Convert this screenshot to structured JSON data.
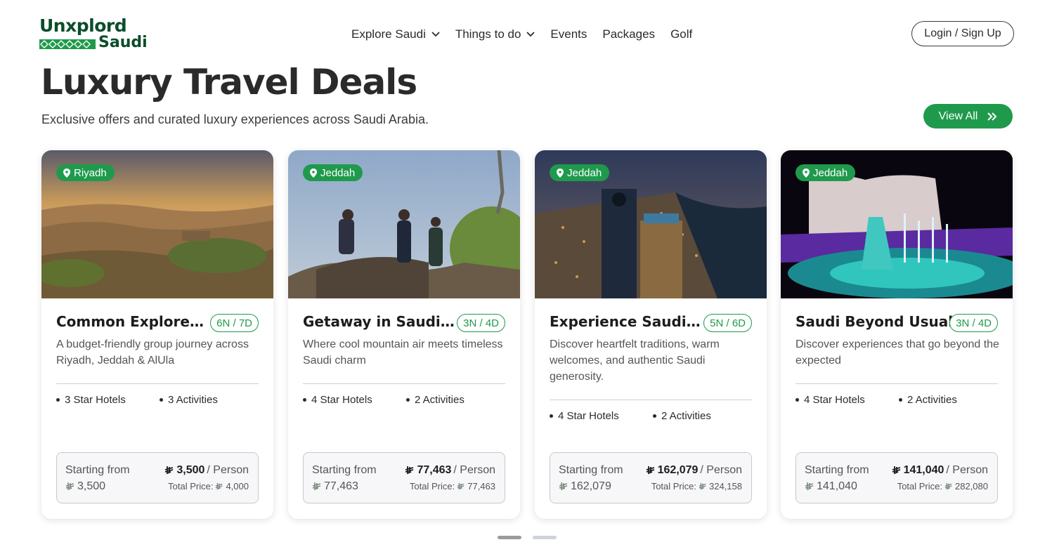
{
  "brand": {
    "logo_line1": "Unxplord",
    "logo_line2": "Saudi",
    "green": "#1f9a4c",
    "dark_green": "#0b4d2a"
  },
  "nav": {
    "items": [
      {
        "label": "Explore Saudi",
        "has_dropdown": true
      },
      {
        "label": "Things to do",
        "has_dropdown": true
      },
      {
        "label": "Events",
        "has_dropdown": false
      },
      {
        "label": "Packages",
        "has_dropdown": false
      },
      {
        "label": "Golf",
        "has_dropdown": false
      }
    ],
    "login_label": "Login / Sign Up"
  },
  "section": {
    "title": "Luxury Travel Deals",
    "subtitle": "Exclusive offers and curated luxury experiences across Saudi Arabia.",
    "view_all_label": "View All"
  },
  "cards": [
    {
      "location": "Riyadh",
      "title": "Common Explorer Saudi",
      "duration": "6N / 7D",
      "description": "A budget-friendly group journey across Riyadh, Jeddah & AlUla",
      "hotels": "3 Star Hotels",
      "activities": "3 Activities",
      "starting_label": "Starting from",
      "price": "3,500",
      "per_person": "/ Person",
      "starting_value": "3,500",
      "total_label": "Total Price:",
      "total_value": "4,000",
      "image": "desert-valley-photo"
    },
    {
      "location": "Jeddah",
      "title": "Getaway in Saudi Highlands",
      "duration": "3N / 4D",
      "description": "Where cool mountain air meets timeless Saudi charm",
      "hotels": "4 Star Hotels",
      "activities": "2 Activities",
      "starting_label": "Starting from",
      "price": "77,463",
      "per_person": "/ Person",
      "starting_value": "77,463",
      "total_label": "Total Price:",
      "total_value": "77,463",
      "image": "hikers-mountain-photo"
    },
    {
      "location": "Jeddah",
      "title": "Experience Saudi Hospitality",
      "duration": "5N / 6D",
      "description": "Discover heartfelt traditions, warm welcomes, and authentic Saudi generosity.",
      "hotels": "4 Star Hotels",
      "activities": "2 Activities",
      "starting_label": "Starting from",
      "price": "162,079",
      "per_person": "/ Person",
      "starting_value": "162,079",
      "total_label": "Total Price:",
      "total_value": "324,158",
      "image": "city-night-skyline-photo"
    },
    {
      "location": "Jeddah",
      "title": "Saudi Beyond Usual",
      "duration": "3N / 4D",
      "description": "Discover experiences that go beyond the expected",
      "hotels": "4 Star Hotels",
      "activities": "2 Activities",
      "starting_label": "Starting from",
      "price": "141,040",
      "per_person": "/ Person",
      "starting_value": "141,040",
      "total_label": "Total Price:",
      "total_value": "282,080",
      "image": "illuminated-fountain-photo"
    }
  ],
  "pagination": {
    "pages": 2,
    "active": 1
  }
}
